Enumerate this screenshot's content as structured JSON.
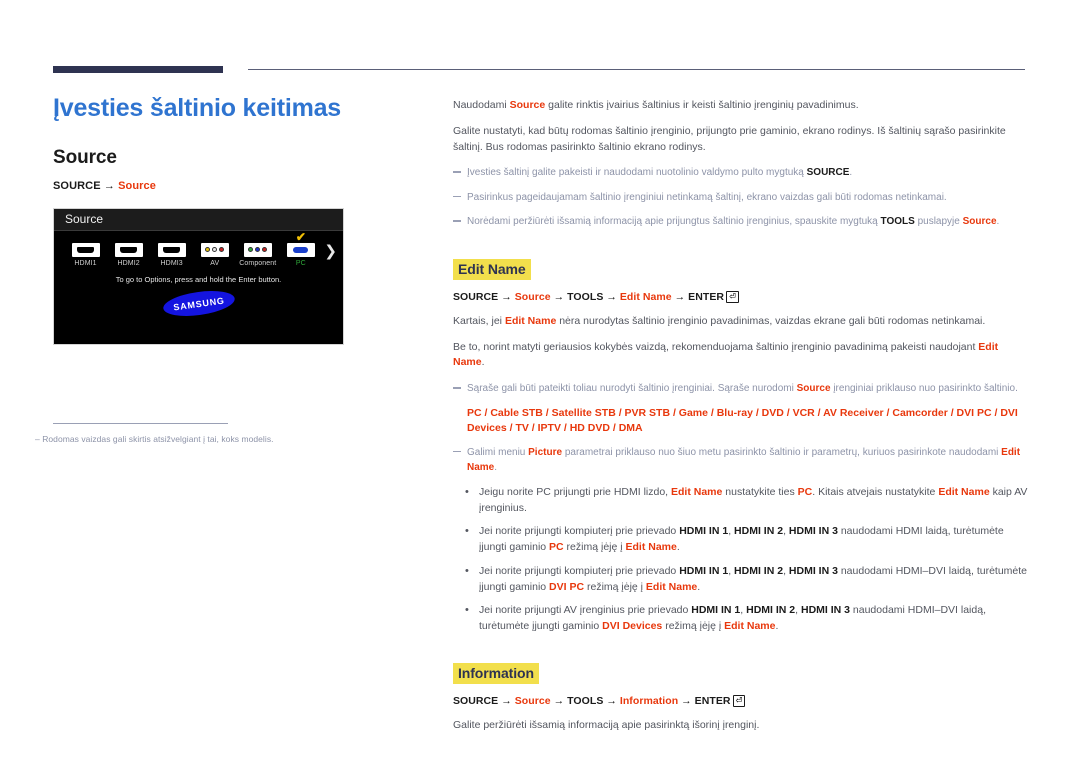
{
  "header": {
    "bar_color": "#2e3351",
    "rule_color": "#5a5f78"
  },
  "left": {
    "page_title": "Įvesties šaltinio keitimas",
    "section_title": "Source",
    "path": {
      "key": "SOURCE",
      "arrow": "→",
      "target": "Source"
    },
    "tv": {
      "menu_title": "Source",
      "sources": [
        {
          "label": "HDMI1",
          "icon": "hdmi-port-icon",
          "selected": false
        },
        {
          "label": "HDMI2",
          "icon": "hdmi-port-icon",
          "selected": false
        },
        {
          "label": "HDMI3",
          "icon": "hdmi-port-icon",
          "selected": false
        },
        {
          "label": "AV",
          "icon": "av-rca-icon",
          "selected": false
        },
        {
          "label": "Component",
          "icon": "component-rca-icon",
          "selected": false
        },
        {
          "label": "PC",
          "icon": "vga-port-icon",
          "selected": true
        }
      ],
      "next_arrow": "❯",
      "hint": "To go to Options, press and hold the Enter button.",
      "brand": "SAMSUNG"
    },
    "footnote": {
      "dash": "–",
      "text": "Rodomas vaizdas gali skirtis atsižvelgiant į tai, koks modelis."
    }
  },
  "right": {
    "intro": {
      "p1_a": "Naudodami ",
      "p1_src": "Source",
      "p1_b": " galite rinktis įvairius šaltinius ir keisti šaltinio įrenginių pavadinimus.",
      "p2": "Galite nustatyti, kad būtų rodomas šaltinio įrenginio, prijungto prie gaminio, ekrano rodinys. Iš šaltinių sąrašo pasirinkite šaltinį. Bus rodomas pasirinkto šaltinio ekrano rodinys."
    },
    "intro_notes": [
      {
        "a": "Įvesties šaltinį galite pakeisti ir naudodami nuotolinio valdymo pulto mygtuką ",
        "bold": "SOURCE",
        "b": "."
      },
      {
        "a": "Pasirinkus pageidaujamam šaltinio įrenginiui netinkamą šaltinį, ekrano vaizdas gali būti rodomas netinkamai.",
        "bold": "",
        "b": ""
      },
      {
        "a": "Norėdami peržiūrėti išsamią informaciją apie prijungtus šaltinio įrenginius, spauskite mygtuką ",
        "bold": "TOOLS",
        "b": " puslapyje ",
        "red": "Source",
        "c": "."
      }
    ],
    "edit_name": {
      "heading": "Edit Name",
      "crumb": {
        "k1": "SOURCE",
        "r1": "Source",
        "k2": "TOOLS",
        "r2": "Edit Name",
        "k3": "ENTER",
        "arrow": "→",
        "enter_glyph": "⏎"
      },
      "p1_a": "Kartais, jei ",
      "p1_r": "Edit Name",
      "p1_b": " nėra nurodytas šaltinio įrenginio pavadinimas, vaizdas ekrane gali būti rodomas netinkamai.",
      "p2_a": "Be to, norint matyti geriausios kokybės vaizdą, rekomenduojama šaltinio įrenginio pavadinimą pakeisti naudojant ",
      "p2_r": "Edit Name",
      "p2_b": ".",
      "note1_a": "Sąraše gali būti pateikti toliau nurodyti šaltinio įrenginiai. Sąraše nurodomi ",
      "note1_r": "Source",
      "note1_b": " įrenginiai priklauso nuo pasirinkto šaltinio.",
      "device_list": "PC / Cable STB / Satellite STB / PVR STB / Game / Blu-ray / DVD / VCR / AV Receiver / Camcorder / DVI PC / DVI Devices / TV / IPTV / HD DVD / DMA",
      "note2_a": "Galimi meniu ",
      "note2_r1": "Picture",
      "note2_b": " parametrai priklauso nuo šiuo metu pasirinkto šaltinio ir parametrų, kuriuos pasirinkote naudodami ",
      "note2_r2": "Edit Name",
      "note2_c": ".",
      "bullets": [
        {
          "a": "Jeigu norite PC prijungti prie HDMI lizdo, ",
          "r1": "Edit Name",
          "b": " nustatykite ties ",
          "r2": "PC",
          "c": ". Kitais atvejais nustatykite ",
          "r3": "Edit Name",
          "d": " kaip AV įrenginius."
        },
        {
          "a": "Jei norite prijungti kompiuterį prie prievado ",
          "k1": "HDMI IN 1",
          "s1": ", ",
          "k2": "HDMI IN 2",
          "s2": ", ",
          "k3": "HDMI IN 3",
          "b": " naudodami HDMI laidą, turėtumėte įjungti gaminio ",
          "r1": "PC",
          "c": " režimą įėję į ",
          "r2": "Edit Name",
          "d": "."
        },
        {
          "a": "Jei norite prijungti kompiuterį prie prievado ",
          "k1": "HDMI IN 1",
          "s1": ", ",
          "k2": "HDMI IN 2",
          "s2": ", ",
          "k3": "HDMI IN 3",
          "b": " naudodami HDMI–DVI laidą, turėtumėte įjungti gaminio ",
          "r1": "DVI PC",
          "c": " režimą įėję į ",
          "r2": "Edit Name",
          "d": "."
        },
        {
          "a": "Jei norite prijungti AV įrenginius prie prievado ",
          "k1": "HDMI IN 1",
          "s1": ", ",
          "k2": "HDMI IN 2",
          "s2": ", ",
          "k3": "HDMI IN 3",
          "b": " naudodami HDMI–DVI laidą, turėtumėte įjungti gaminio ",
          "r1": "DVI Devices",
          "c": " režimą įėję į ",
          "r2": "Edit Name",
          "d": "."
        }
      ]
    },
    "information": {
      "heading": "Information",
      "crumb": {
        "k1": "SOURCE",
        "r1": "Source",
        "k2": "TOOLS",
        "r2": "Information",
        "k3": "ENTER",
        "arrow": "→",
        "enter_glyph": "⏎"
      },
      "p1": "Galite peržiūrėti išsamią informaciją apie pasirinktą išorinį įrenginį."
    }
  },
  "colors": {
    "accent_blue": "#2f74d0",
    "accent_red": "#e8380d",
    "highlight_yellow": "#f2df4c",
    "navy": "#2e3351",
    "body_gray": "#53565f",
    "note_gray": "#8d93a8"
  }
}
